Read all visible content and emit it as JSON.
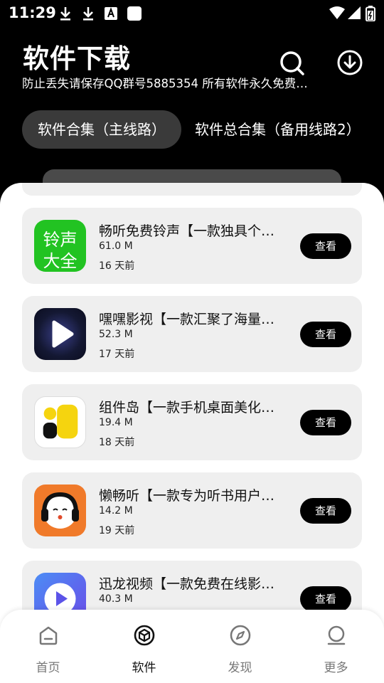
{
  "status_bar": {
    "time": "11:29"
  },
  "header": {
    "title": "软件下载",
    "subtitle": "防止丢失请保存QQ群号5885354 所有软件永久免费…"
  },
  "tabs": [
    {
      "label": "软件合集（主线路）",
      "active": true
    },
    {
      "label": "软件总合集（备用线路2）",
      "active": false
    }
  ],
  "apps": [
    {
      "title": "畅听免费铃声【一款独具个…",
      "size": "61.0 M",
      "time": "16 天前",
      "button": "查看",
      "icon": "ringtone-icon",
      "icon_text_1": "铃声",
      "icon_text_2": "大全",
      "icon_color": "#22c322"
    },
    {
      "title": "嘿嘿影视【一款汇聚了海量…",
      "size": "52.3 M",
      "time": "17 天前",
      "button": "查看",
      "icon": "play-video-icon",
      "icon_color": "#141833"
    },
    {
      "title": "组件岛【一款手机桌面美化…",
      "size": "19.4 M",
      "time": "18 天前",
      "button": "查看",
      "icon": "widget-island-icon",
      "icon_color": "#ffffff"
    },
    {
      "title": "懒畅听【一款专为听书用户…",
      "size": "14.2 M",
      "time": "19 天前",
      "button": "查看",
      "icon": "headphones-icon",
      "icon_color": "#f07a2a"
    },
    {
      "title": "迅龙视频【一款免费在线影…",
      "size": "40.3 M",
      "time": "",
      "button": "查看",
      "icon": "video-play-icon",
      "icon_color": "#5b53e8"
    }
  ],
  "nav": [
    {
      "label": "首页",
      "icon": "home-icon",
      "active": false
    },
    {
      "label": "软件",
      "icon": "cube-icon",
      "active": true
    },
    {
      "label": "发现",
      "icon": "compass-icon",
      "active": false
    },
    {
      "label": "更多",
      "icon": "profile-icon",
      "active": false
    }
  ]
}
